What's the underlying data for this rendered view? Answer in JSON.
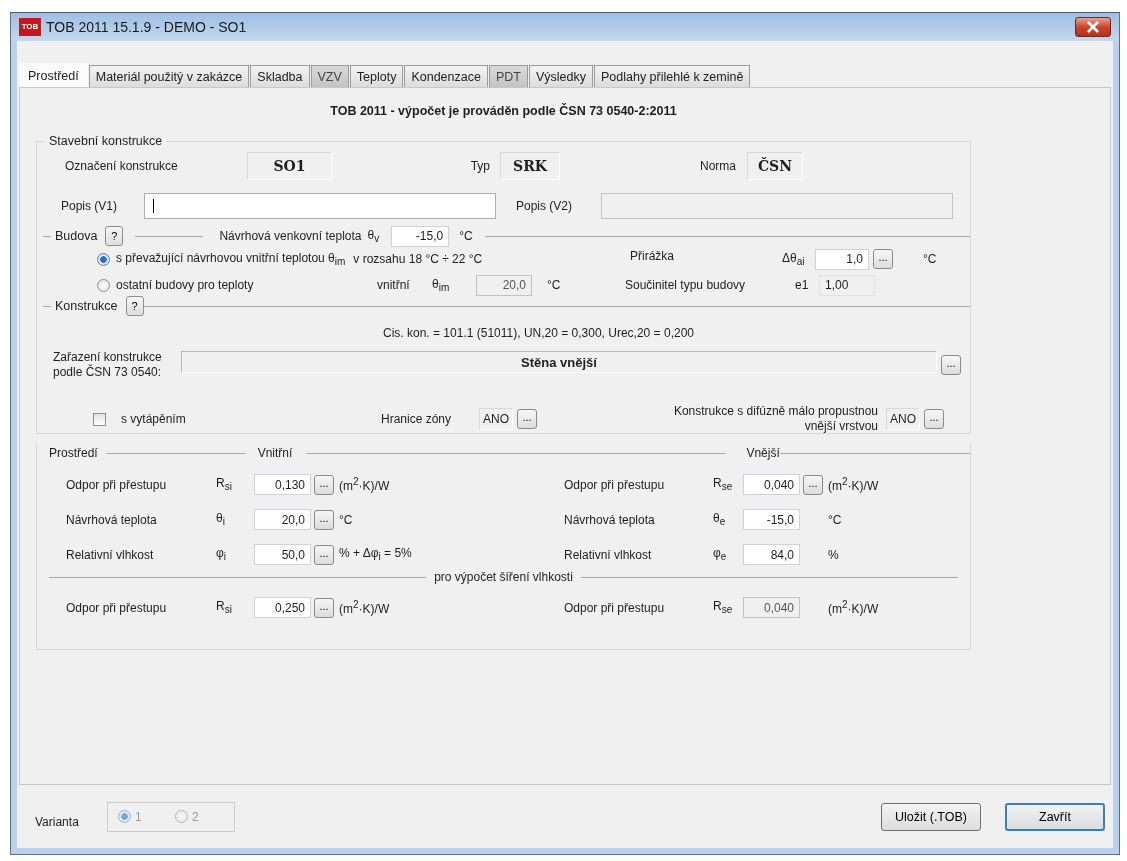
{
  "window": {
    "title": "TOB 2011 15.1.9 - DEMO - SO1",
    "app_logo": "TOB"
  },
  "tabs": [
    {
      "label": "Prostředí",
      "selected": true,
      "disabled": false
    },
    {
      "label": "Materiál použitý v zakázce",
      "selected": false,
      "disabled": false
    },
    {
      "label": "Skladba",
      "selected": false,
      "disabled": false
    },
    {
      "label": "VZV",
      "selected": false,
      "disabled": true
    },
    {
      "label": "Teploty",
      "selected": false,
      "disabled": false
    },
    {
      "label": "Kondenzace",
      "selected": false,
      "disabled": false
    },
    {
      "label": "PDT",
      "selected": false,
      "disabled": true
    },
    {
      "label": "Výsledky",
      "selected": false,
      "disabled": false
    },
    {
      "label": "Podlahy přilehlé k zemině",
      "selected": false,
      "disabled": false
    }
  ],
  "heading": "TOB 2011 - výpočet je prováděn podle ČSN 73 0540-2:2011",
  "construction": {
    "legend": "Stavební konstrukce",
    "designation_label": "Označení konstrukce",
    "designation": "SO1",
    "type_label": "Typ",
    "type": "SRK",
    "norm_label": "Norma",
    "norm": "ČSN",
    "desc1_label": "Popis (V1)",
    "desc2_label": "Popis (V2)"
  },
  "building": {
    "label": "Budova",
    "help": "?",
    "outdoor": {
      "label": "Návrhová venkovní teplota",
      "symbol": "θ$_{v}$",
      "value": "-15,0",
      "unit": "°C",
      "disabled": false
    },
    "options": [
      {
        "label": "s převažující návrhovou vnitřní teplotou θ$_{im}$",
        "selected": true
      },
      {
        "label": "ostatní budovy pro teploty",
        "selected": false
      }
    ],
    "range": "v rozsahu 18 °C ÷ 22 °C",
    "surcharge": {
      "label": "Přirážka",
      "symbol": "Δθ$_{ai}$",
      "value": "1,0",
      "button": "...",
      "unit": "°C",
      "disabled": false
    },
    "inner": {
      "label": "vnitřní",
      "symbol": "θ$_{im}$",
      "value": "20,0",
      "unit": "°C",
      "disabled": true
    },
    "coef": {
      "label": "Součinitel typu budovy",
      "symbol": "e1",
      "value": "1,00",
      "disabled": false
    }
  },
  "structure": {
    "label": "Konstrukce",
    "help": "?",
    "info": "Cis. kon. = 101.1 (51011), UN,20 = 0,300, Urec,20 = 0,200",
    "class_label": "Zařazení konstrukce podle ČSN 73 0540:",
    "class_value": "Stěna vnější",
    "class_button": "...",
    "heated": {
      "label": "s vytápěním",
      "checked": false
    },
    "zone": {
      "label": "Hranice zóny",
      "value": "ANO",
      "button": "..."
    },
    "diffusion": {
      "label": "Konstrukce s difúzně  málo propustnou vnější vrstvou",
      "value": "ANO",
      "button": "..."
    }
  },
  "environment": {
    "legend": "Prostředí",
    "inner_heading": "Vnitřní",
    "outer_heading": "Vnější",
    "rows": [
      {
        "inner": {
          "label": "Odpor při přestupu",
          "symbol": "R$_{si}$",
          "value": "0,130",
          "button": "...",
          "unit": "(m$^{2}$·K)/W",
          "disabled": false
        },
        "outer": {
          "label": "Odpor při přestupu",
          "symbol": "R$_{se}$",
          "value": "0,040",
          "button": "...",
          "unit": "(m$^{2}$·K)/W",
          "disabled": false
        }
      },
      {
        "inner": {
          "label": "Návrhová teplota",
          "symbol": "θ$_{i}$",
          "value": "20,0",
          "button": "...",
          "unit": "°C",
          "disabled": false
        },
        "outer": {
          "label": "Návrhová teplota",
          "symbol": "θ$_{e}$",
          "value": "-15,0",
          "unit": "°C",
          "disabled": false
        }
      },
      {
        "inner": {
          "label": "Relativní vlhkost",
          "symbol": "φ$_{i}$",
          "value": "50,0",
          "button": "...",
          "unit": "% + Δφ$_{i}$ = 5%",
          "disabled": false
        },
        "outer": {
          "label": "Relativní vlhkost",
          "symbol": "φ$_{e}$",
          "value": "84,0",
          "unit": "%",
          "disabled": false
        }
      }
    ],
    "moisture_heading": "pro výpočet šíření vlhkosti",
    "moisture_rows": [
      {
        "inner": {
          "label": "Odpor při přestupu",
          "symbol": "R$_{si}$",
          "value": "0,250",
          "button": "...",
          "unit": "(m$^{2}$·K)/W",
          "disabled": false
        },
        "outer": {
          "label": "Odpor při přestupu",
          "symbol": "R$_{se}$",
          "value": "0,040",
          "unit": "(m$^{2}$·K)/W",
          "disabled": true
        }
      }
    ]
  },
  "footer": {
    "variant_label": "Varianta",
    "variants": [
      {
        "label": "1",
        "selected": true
      },
      {
        "label": "2",
        "selected": false
      }
    ],
    "buttons": [
      {
        "label": "Uložit (.TOB)",
        "default": false
      },
      {
        "label": "Zavřít",
        "default": true
      }
    ]
  }
}
